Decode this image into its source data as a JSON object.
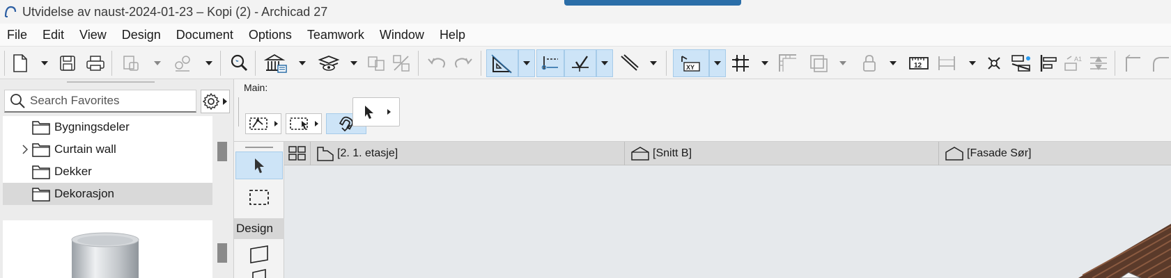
{
  "window": {
    "title": "Utvidelse av naust-2024-01-23 – Kopi (2) - Archicad 27",
    "accent_color": "#2b6ea8"
  },
  "menu": [
    "File",
    "Edit",
    "View",
    "Design",
    "Document",
    "Options",
    "Teamwork",
    "Window",
    "Help"
  ],
  "toolbar": {
    "icons": [
      "new-file-icon",
      "save-icon",
      "print-icon",
      "publish-icon",
      "teamwork-icon",
      "find-select-icon",
      "building-icon",
      "layers-icon",
      "undo-icon",
      "redo-icon",
      "guide-lines-icon",
      "snap-icon",
      "cursor-snap-icon",
      "xy-coordinates-icon",
      "grid-icon",
      "ruler-12-icon"
    ],
    "ruler_text": "12",
    "xy_text": "XY"
  },
  "favorites": {
    "search_placeholder": "Search Favorites",
    "items": [
      {
        "label": "Bygningsdeler",
        "expandable": false,
        "selected": false
      },
      {
        "label": "Curtain wall",
        "expandable": true,
        "selected": false
      },
      {
        "label": "Dekker",
        "expandable": false,
        "selected": false
      },
      {
        "label": "Dekorasjon",
        "expandable": false,
        "selected": true
      }
    ]
  },
  "infobox": {
    "label": "Main:"
  },
  "toolbox": {
    "section_label": "Design"
  },
  "tabs": [
    {
      "label": "[2. 1. etasje]",
      "icon": "floor-plan-icon"
    },
    {
      "label": "[Snitt B]",
      "icon": "section-icon"
    },
    {
      "label": "[Fasade Sør]",
      "icon": "elevation-icon"
    }
  ],
  "colors": {
    "active_bg": "#cde4f7",
    "canvas_bg": "#e6e9ec"
  }
}
